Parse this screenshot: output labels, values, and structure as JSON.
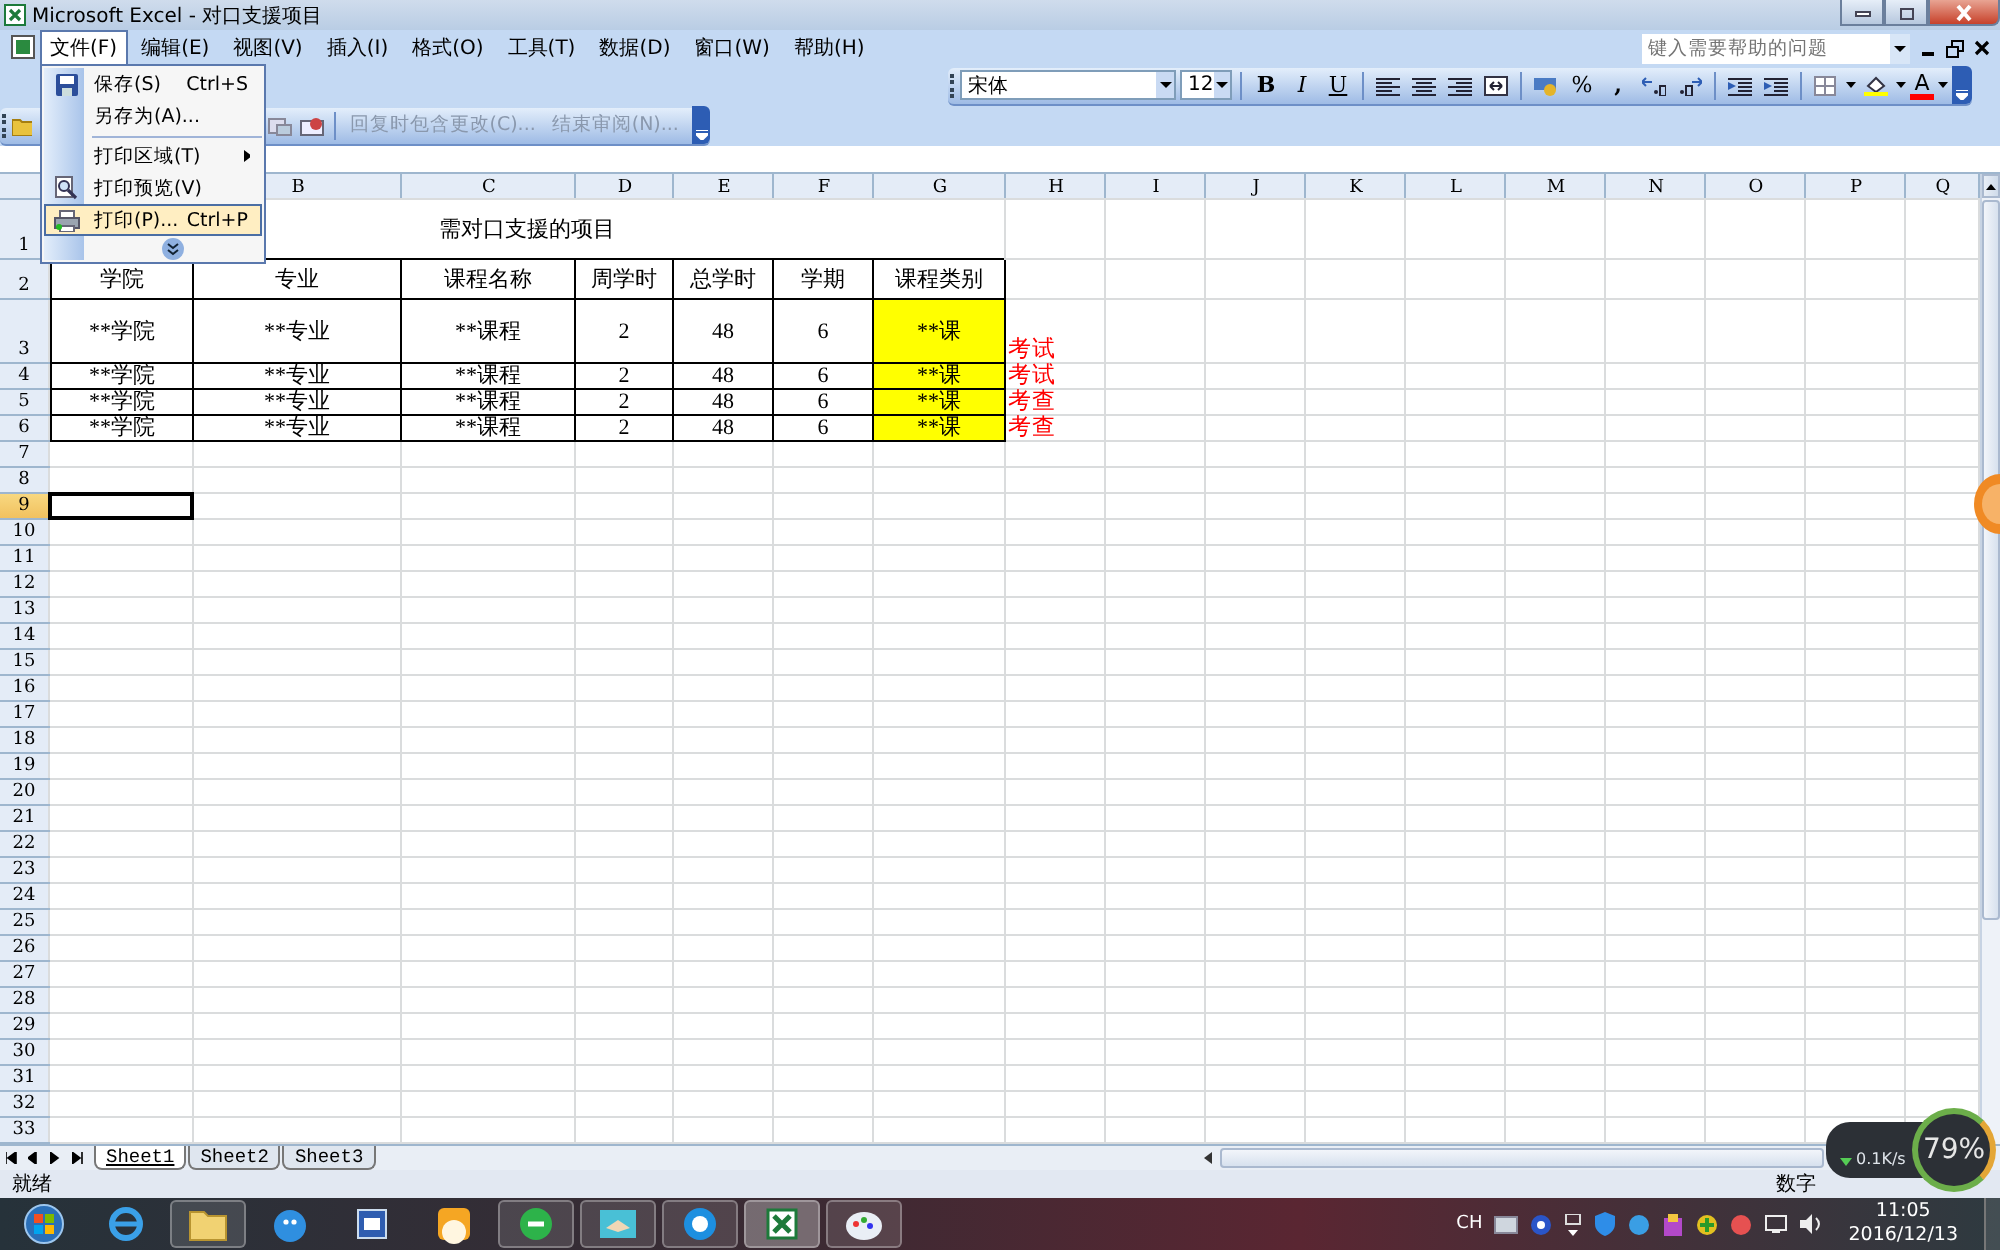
{
  "window": {
    "title": "Microsoft Excel - 对口支援项目"
  },
  "menu": [
    {
      "label": "文件(F)",
      "selected": true
    },
    {
      "label": "编辑(E)",
      "selected": false
    },
    {
      "label": "视图(V)",
      "selected": false
    },
    {
      "label": "插入(I)",
      "selected": false
    },
    {
      "label": "格式(O)",
      "selected": false
    },
    {
      "label": "工具(T)",
      "selected": false
    },
    {
      "label": "数据(D)",
      "selected": false
    },
    {
      "label": "窗口(W)",
      "selected": false
    },
    {
      "label": "帮助(H)",
      "selected": false
    }
  ],
  "help_box": {
    "placeholder": "键入需要帮助的问题"
  },
  "formatting_toolbar": {
    "font": "宋体",
    "size": "12",
    "bold": "B",
    "italic": "I",
    "underline": "U",
    "percent": "%",
    "comma": ",",
    "font_color": "A"
  },
  "review_toolbar": {
    "items": [
      {
        "label": "回复时包含更改(C)...",
        "disabled": true
      },
      {
        "label": "结束审阅(N)...",
        "disabled": true
      }
    ]
  },
  "file_menu": {
    "items": [
      {
        "kind": "item",
        "label": "保存(S)",
        "shortcut": "Ctrl+S",
        "selected": false
      },
      {
        "kind": "item",
        "label": "另存为(A)...",
        "selected": false
      },
      {
        "kind": "separator"
      },
      {
        "kind": "submenu",
        "label": "打印区域(T)",
        "selected": false
      },
      {
        "kind": "item",
        "label": "打印预览(V)",
        "selected": false
      },
      {
        "kind": "item",
        "label": "打印(P)...",
        "shortcut": "Ctrl+P",
        "selected": true
      },
      {
        "kind": "expand"
      }
    ]
  },
  "sheet": {
    "columns": [
      "B",
      "C",
      "D",
      "E",
      "F",
      "G",
      "H",
      "I",
      "J",
      "K",
      "L",
      "M",
      "N",
      "O",
      "P",
      "Q"
    ],
    "rows": [
      {
        "number": "1",
        "kind": "title",
        "selected": false,
        "title": "需对口支援的项目"
      },
      {
        "number": "2",
        "kind": "header",
        "selected": false,
        "cells": [
          "学院",
          "专业",
          "课程名称",
          "周学时",
          "总学时",
          "学期",
          "课程类别"
        ]
      },
      {
        "number": "3",
        "kind": "data",
        "selected": false,
        "cells": [
          "**学院",
          "**专业",
          "**课程",
          "2",
          "48",
          "6",
          "**课"
        ],
        "note": "考试"
      },
      {
        "number": "4",
        "kind": "data",
        "selected": false,
        "cells": [
          "**学院",
          "**专业",
          "**课程",
          "2",
          "48",
          "6",
          "**课"
        ],
        "note": "考试"
      },
      {
        "number": "5",
        "kind": "data",
        "selected": false,
        "cells": [
          "**学院",
          "**专业",
          "**课程",
          "2",
          "48",
          "6",
          "**课"
        ],
        "note": "考查"
      },
      {
        "number": "6",
        "kind": "data",
        "selected": false,
        "cells": [
          "**学院",
          "**专业",
          "**课程",
          "2",
          "48",
          "6",
          "**课"
        ],
        "note": "考查"
      },
      {
        "number": "7",
        "kind": "empty",
        "selected": false
      },
      {
        "number": "8",
        "kind": "empty",
        "selected": false
      },
      {
        "number": "9",
        "kind": "empty",
        "selected": true
      },
      {
        "number": "10",
        "kind": "empty",
        "selected": false
      },
      {
        "number": "11",
        "kind": "empty",
        "selected": false
      },
      {
        "number": "12",
        "kind": "empty",
        "selected": false
      },
      {
        "number": "13",
        "kind": "empty",
        "selected": false
      },
      {
        "number": "14",
        "kind": "empty",
        "selected": false
      },
      {
        "number": "15",
        "kind": "empty",
        "selected": false
      },
      {
        "number": "16",
        "kind": "empty",
        "selected": false
      },
      {
        "number": "17",
        "kind": "empty",
        "selected": false
      },
      {
        "number": "18",
        "kind": "empty",
        "selected": false
      },
      {
        "number": "19",
        "kind": "empty",
        "selected": false
      },
      {
        "number": "20",
        "kind": "empty",
        "selected": false
      },
      {
        "number": "21",
        "kind": "empty",
        "selected": false
      },
      {
        "number": "22",
        "kind": "empty",
        "selected": false
      },
      {
        "number": "23",
        "kind": "empty",
        "selected": false
      },
      {
        "number": "24",
        "kind": "empty",
        "selected": false
      },
      {
        "number": "25",
        "kind": "empty",
        "selected": false
      },
      {
        "number": "26",
        "kind": "empty",
        "selected": false
      },
      {
        "number": "27",
        "kind": "empty",
        "selected": false
      },
      {
        "number": "28",
        "kind": "empty",
        "selected": false
      },
      {
        "number": "29",
        "kind": "empty",
        "selected": false
      },
      {
        "number": "30",
        "kind": "empty",
        "selected": false
      },
      {
        "number": "31",
        "kind": "empty",
        "selected": false
      },
      {
        "number": "32",
        "kind": "empty",
        "selected": false
      },
      {
        "number": "33",
        "kind": "empty",
        "selected": false
      }
    ]
  },
  "sheet_tabs": [
    {
      "label": "Sheet1",
      "selected": true
    },
    {
      "label": "Sheet2",
      "selected": false
    },
    {
      "label": "Sheet3",
      "selected": false
    }
  ],
  "status_bar": {
    "state": "就绪",
    "mode": "数字"
  },
  "net_widget": {
    "speed": "0.1K/s",
    "percent": "79%"
  },
  "taskbar": {
    "language": "CH",
    "time": "11:05",
    "date": "2016/12/13"
  }
}
